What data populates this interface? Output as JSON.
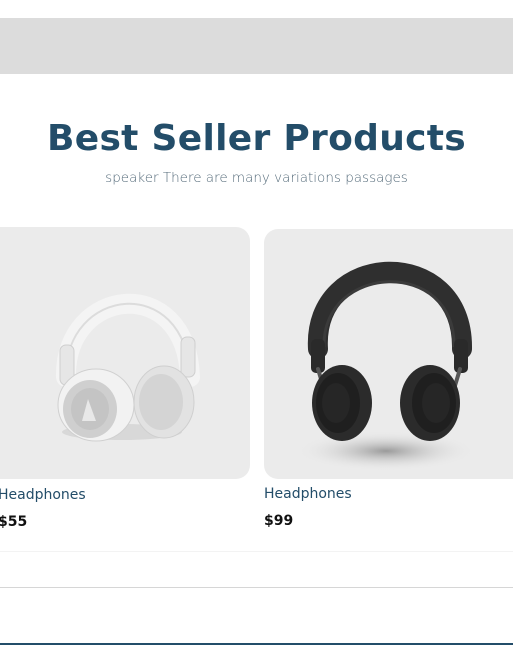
{
  "section": {
    "title": "Best Seller Products",
    "subtitle": "speaker There are many variations passages"
  },
  "products": [
    {
      "name": "Headphones",
      "price": "$55",
      "image": "white-headphones"
    },
    {
      "name": "Headphones",
      "price": "$99",
      "image": "black-headphones"
    }
  ],
  "colors": {
    "title": "#234d69",
    "card_bg": "#ebebeb",
    "banner": "#dcdcdc"
  }
}
